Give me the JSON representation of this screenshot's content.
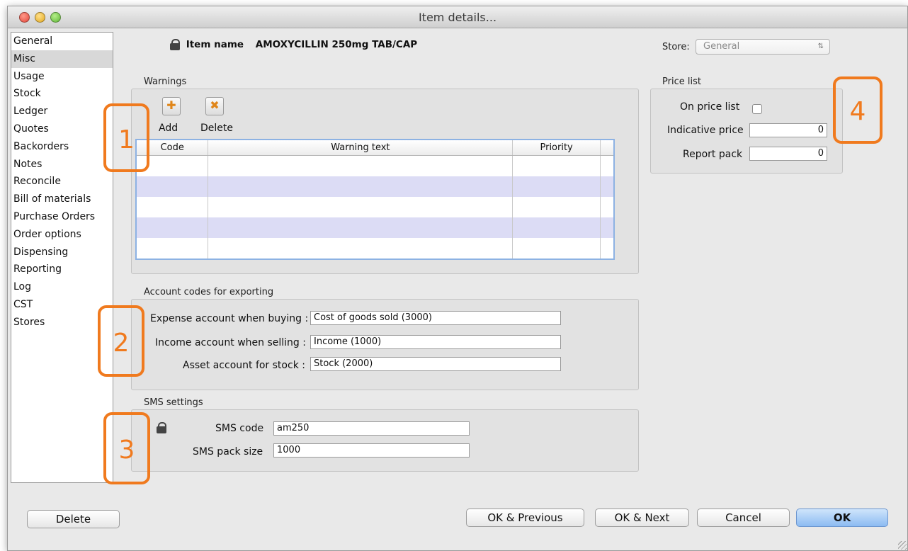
{
  "window": {
    "title": "Item details..."
  },
  "sidebar": {
    "items": [
      {
        "label": "General"
      },
      {
        "label": "Misc",
        "selected": true
      },
      {
        "label": "Usage"
      },
      {
        "label": "Stock"
      },
      {
        "label": "Ledger"
      },
      {
        "label": "Quotes"
      },
      {
        "label": "Backorders"
      },
      {
        "label": "Notes"
      },
      {
        "label": "Reconcile"
      },
      {
        "label": "Bill of materials"
      },
      {
        "label": "Purchase Orders"
      },
      {
        "label": "Order options"
      },
      {
        "label": "Dispensing"
      },
      {
        "label": "Reporting"
      },
      {
        "label": "Log"
      },
      {
        "label": "CST"
      },
      {
        "label": "Stores"
      }
    ]
  },
  "item": {
    "name_label": "Item name",
    "name_value": "AMOXYCILLIN 250mg TAB/CAP",
    "lock_icon": "lock-icon"
  },
  "store": {
    "label": "Store:",
    "selected": "General"
  },
  "warnings": {
    "section_label": "Warnings",
    "add_label": "Add",
    "delete_label": "Delete",
    "columns": [
      "Code",
      "Warning text",
      "Priority"
    ],
    "rows": []
  },
  "price_list": {
    "section_label": "Price list",
    "on_price_list_label": "On price list",
    "on_price_list": false,
    "indicative_price_label": "Indicative price",
    "indicative_price": "0",
    "report_pack_label": "Report pack",
    "report_pack": "0"
  },
  "accounts": {
    "section_label": "Account codes for exporting",
    "expense_label": "Expense account when buying :",
    "expense_value": "Cost of goods sold (3000)",
    "income_label": "Income account when selling :",
    "income_value": "Income (1000)",
    "asset_label": "Asset account for stock :",
    "asset_value": "Stock (2000)"
  },
  "sms": {
    "section_label": "SMS settings",
    "code_label": "SMS code",
    "code_value": "am250",
    "pack_label": "SMS pack size",
    "pack_value": "1000"
  },
  "footer": {
    "delete_label": "Delete",
    "ok_previous_label": "OK & Previous",
    "ok_next_label": "OK & Next",
    "cancel_label": "Cancel",
    "ok_label": "OK"
  },
  "callouts": [
    "1",
    "2",
    "3",
    "4"
  ],
  "colors": {
    "callout": "#f07a1e",
    "selected_row": "#d8d8d8",
    "alt_row": "#dcdcf5",
    "default_button": "#8cbbf2"
  }
}
